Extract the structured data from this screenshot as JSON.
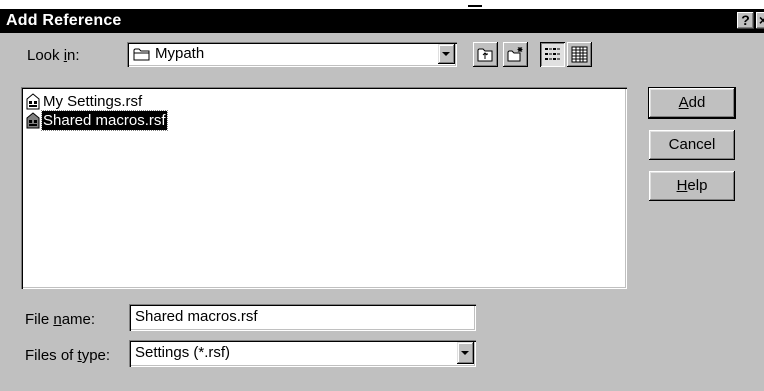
{
  "window": {
    "title": "Add Reference",
    "help_button": "?",
    "close_button": "×"
  },
  "look_in": {
    "label_pre": "Look ",
    "label_key": "i",
    "label_post": "n:",
    "value": "Mypath",
    "icon": "folder-icon"
  },
  "toolbar": {
    "up_folder_icon": "up-one-level-icon",
    "new_folder_icon": "create-new-folder-icon",
    "list_view_icon": "list-view-icon",
    "details_view_icon": "details-view-icon",
    "active_view": "list"
  },
  "files": [
    {
      "name": "My Settings.rsf",
      "icon": "settings-file-icon",
      "selected": false
    },
    {
      "name": "Shared macros.rsf",
      "icon": "settings-file-icon",
      "selected": true
    }
  ],
  "buttons": {
    "add_key": "A",
    "add_rest": "dd",
    "cancel": "Cancel",
    "help_key": "H",
    "help_rest": "elp"
  },
  "file_name": {
    "label_pre": "File ",
    "label_key": "n",
    "label_post": "ame:",
    "value": "Shared macros.rsf"
  },
  "file_type": {
    "label_pre": "Files of ",
    "label_key": "t",
    "label_post": "ype:",
    "value": "Settings (*.rsf)"
  },
  "colors": {
    "title_bar": "#000000",
    "dialog_face": "#c0c0c0",
    "selection": "#000000"
  }
}
